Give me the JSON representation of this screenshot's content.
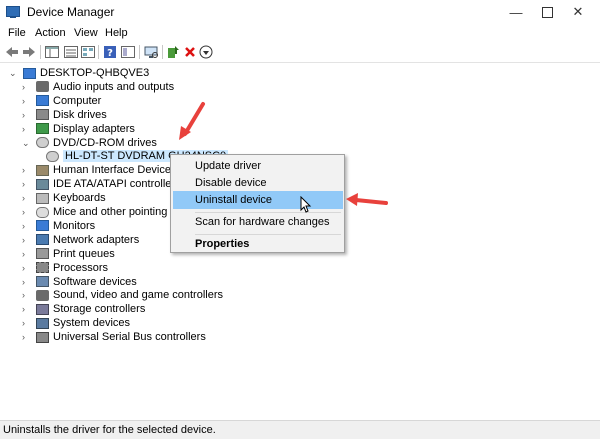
{
  "window": {
    "title": "Device Manager"
  },
  "menu": [
    "File",
    "Action",
    "View",
    "Help"
  ],
  "tree": {
    "root": "DESKTOP-QHBQVE3",
    "categories": [
      {
        "label": "Audio inputs and outputs",
        "icon": "speaker-icon",
        "expanded": false
      },
      {
        "label": "Computer",
        "icon": "monitor-icon",
        "expanded": false
      },
      {
        "label": "Disk drives",
        "icon": "disk-drive-icon",
        "expanded": false
      },
      {
        "label": "Display adapters",
        "icon": "display-adapter-icon",
        "expanded": false
      },
      {
        "label": "DVD/CD-ROM drives",
        "icon": "dvd-drive-icon",
        "expanded": true
      },
      {
        "label": "HL-DT-ST DVDRAM GH24NSC0",
        "icon": "dvd-drive-icon",
        "child": true,
        "selected": true
      },
      {
        "label": "Human Interface Devices",
        "icon": "hid-icon",
        "expanded": false
      },
      {
        "label": "IDE ATA/ATAPI controllers",
        "icon": "ide-controller-icon",
        "expanded": false
      },
      {
        "label": "Keyboards",
        "icon": "keyboard-icon",
        "expanded": false
      },
      {
        "label": "Mice and other pointing devices",
        "icon": "mouse-icon",
        "expanded": false
      },
      {
        "label": "Monitors",
        "icon": "monitor-icon",
        "expanded": false
      },
      {
        "label": "Network adapters",
        "icon": "network-icon",
        "expanded": false
      },
      {
        "label": "Print queues",
        "icon": "printer-icon",
        "expanded": false
      },
      {
        "label": "Processors",
        "icon": "processor-icon",
        "expanded": false
      },
      {
        "label": "Software devices",
        "icon": "software-device-icon",
        "expanded": false
      },
      {
        "label": "Sound, video and game controllers",
        "icon": "speaker-icon",
        "expanded": false
      },
      {
        "label": "Storage controllers",
        "icon": "storage-controller-icon",
        "expanded": false
      },
      {
        "label": "System devices",
        "icon": "system-device-icon",
        "expanded": false
      },
      {
        "label": "Universal Serial Bus controllers",
        "icon": "usb-icon",
        "expanded": false
      }
    ]
  },
  "context_menu": {
    "items": [
      "Update driver",
      "Disable device",
      "Uninstall device",
      "Scan for hardware changes",
      "Properties"
    ],
    "highlighted": "Uninstall device"
  },
  "status": "Uninstalls the driver for the selected device.",
  "colors": {
    "highlight": "#91c9f7",
    "selection": "#cce8ff",
    "annotation_arrow": "#e8413c"
  }
}
